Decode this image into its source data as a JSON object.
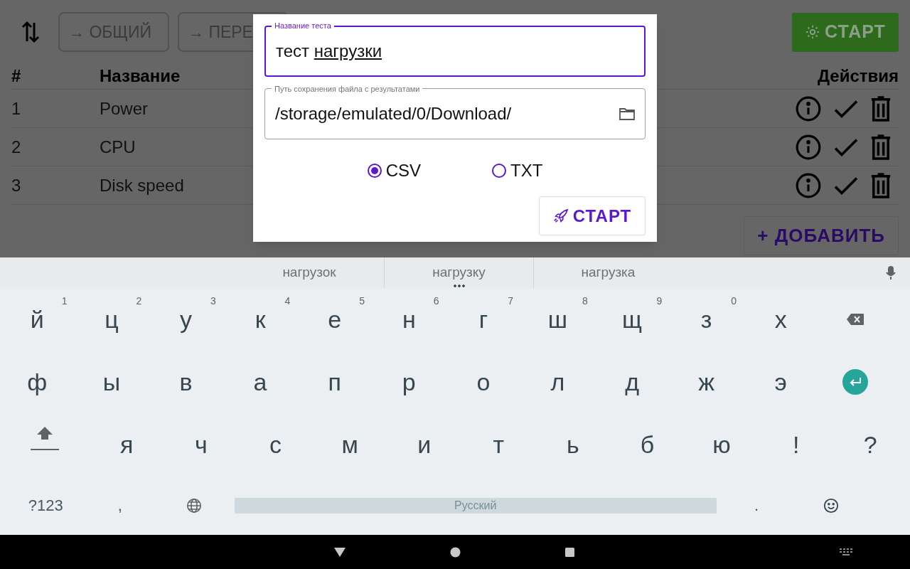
{
  "toolbar": {
    "tabs": [
      {
        "label": "→ ОБЩИЙ"
      },
      {
        "label": "→ ПЕРЕ"
      }
    ],
    "start_button": "СТАРТ"
  },
  "table": {
    "columns": [
      "#",
      "Название",
      "Действия"
    ],
    "rows": [
      {
        "index": "1",
        "name": "Power"
      },
      {
        "index": "2",
        "name": "CPU"
      },
      {
        "index": "3",
        "name": "Disk speed"
      }
    ]
  },
  "add_button": "+ ДОБАВИТЬ",
  "dialog": {
    "name_field": {
      "label": "Название теста",
      "value": "тест",
      "composing": "нагрузки",
      "focused": true
    },
    "path_field": {
      "label": "Путь сохранения файла с результатами",
      "value": "/storage/emulated/0/Download/",
      "focused": false
    },
    "formats": [
      {
        "label": "CSV",
        "selected": true
      },
      {
        "label": "TXT",
        "selected": false
      }
    ],
    "start_button": "СТАРТ"
  },
  "keyboard": {
    "suggestions": [
      {
        "text": "нагрузок",
        "more": false
      },
      {
        "text": "нагрузку",
        "more": true
      },
      {
        "text": "нагрузка",
        "more": false
      }
    ],
    "rows": [
      [
        {
          "kind": "key",
          "label": "й",
          "hint": "1"
        },
        {
          "kind": "key",
          "label": "ц",
          "hint": "2"
        },
        {
          "kind": "key",
          "label": "у",
          "hint": "3"
        },
        {
          "kind": "key",
          "label": "к",
          "hint": "4"
        },
        {
          "kind": "key",
          "label": "е",
          "hint": "5"
        },
        {
          "kind": "key",
          "label": "н",
          "hint": "6"
        },
        {
          "kind": "key",
          "label": "г",
          "hint": "7"
        },
        {
          "kind": "key",
          "label": "ш",
          "hint": "8"
        },
        {
          "kind": "key",
          "label": "щ",
          "hint": "9"
        },
        {
          "kind": "key",
          "label": "з",
          "hint": "0"
        },
        {
          "kind": "key",
          "label": "х"
        },
        {
          "kind": "backspace"
        }
      ],
      [
        {
          "kind": "key",
          "label": "ф"
        },
        {
          "kind": "key",
          "label": "ы"
        },
        {
          "kind": "key",
          "label": "в"
        },
        {
          "kind": "key",
          "label": "а"
        },
        {
          "kind": "key",
          "label": "п"
        },
        {
          "kind": "key",
          "label": "р"
        },
        {
          "kind": "key",
          "label": "о"
        },
        {
          "kind": "key",
          "label": "л"
        },
        {
          "kind": "key",
          "label": "д"
        },
        {
          "kind": "key",
          "label": "ж"
        },
        {
          "kind": "key",
          "label": "э"
        },
        {
          "kind": "enter"
        }
      ],
      [
        {
          "kind": "shift"
        },
        {
          "kind": "key",
          "label": "я"
        },
        {
          "kind": "key",
          "label": "ч"
        },
        {
          "kind": "key",
          "label": "с"
        },
        {
          "kind": "key",
          "label": "м"
        },
        {
          "kind": "key",
          "label": "и"
        },
        {
          "kind": "key",
          "label": "т"
        },
        {
          "kind": "key",
          "label": "ь"
        },
        {
          "kind": "key",
          "label": "б"
        },
        {
          "kind": "key",
          "label": "ю"
        },
        {
          "kind": "key",
          "label": "!"
        },
        {
          "kind": "key",
          "label": "?"
        }
      ],
      [
        {
          "kind": "key",
          "label": "?123"
        },
        {
          "kind": "key",
          "label": ","
        },
        {
          "kind": "globe"
        },
        {
          "kind": "space",
          "label": "Русский"
        },
        {
          "kind": "key",
          "label": "."
        },
        {
          "kind": "emoji"
        }
      ]
    ]
  }
}
